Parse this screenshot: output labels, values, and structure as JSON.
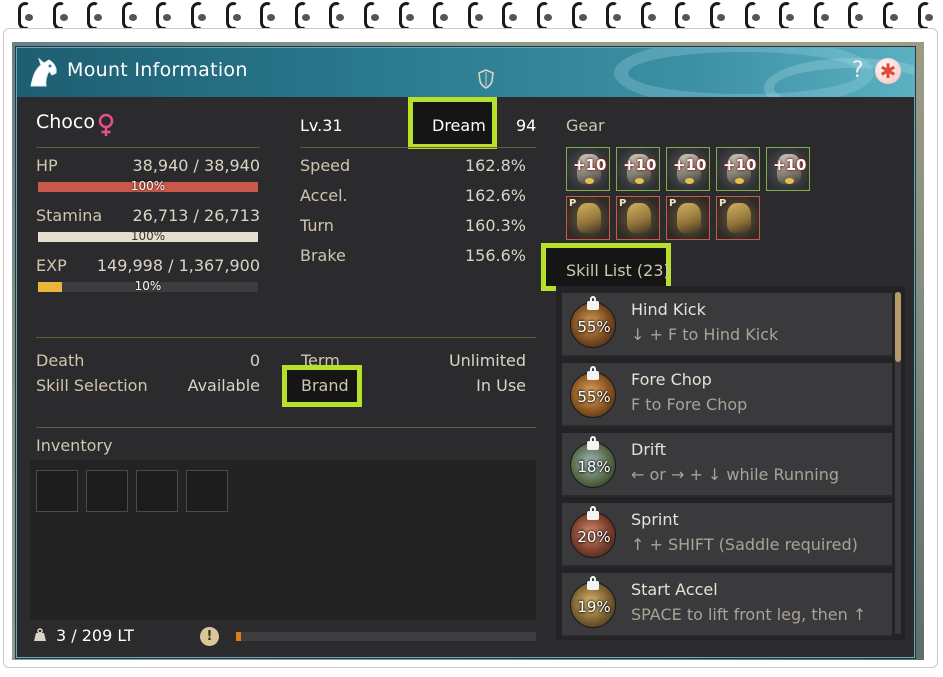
{
  "window": {
    "title": "Mount Information",
    "help_label": "?"
  },
  "mount": {
    "name": "Choco",
    "level": "Lv.31",
    "grade": "Dream",
    "defense_value": "94"
  },
  "stats_left": [
    {
      "label": "HP",
      "value": "38,940 / 38,940",
      "percent_label": "100%",
      "fraction": 1.0,
      "color": "#c8584a"
    },
    {
      "label": "Stamina",
      "value": "26,713 / 26,713",
      "percent_label": "100%",
      "fraction": 1.0,
      "color": "#e4dfcd"
    },
    {
      "label": "EXP",
      "value": "149,998 / 1,367,900",
      "percent_label": "10%",
      "fraction": 0.1097,
      "color": "#e9b53a"
    }
  ],
  "stats_right": [
    {
      "label": "Speed",
      "value": "162.8%"
    },
    {
      "label": "Accel.",
      "value": "162.6%"
    },
    {
      "label": "Turn",
      "value": "160.3%"
    },
    {
      "label": "Brake",
      "value": "156.6%"
    }
  ],
  "info": {
    "death_label": "Death",
    "death_value": "0",
    "skill_selection_label": "Skill Selection",
    "skill_selection_value": "Available",
    "term_label": "Term",
    "term_value": "Unlimited",
    "brand_label": "Brand",
    "brand_value": "In Use"
  },
  "inventory": {
    "label": "Inventory",
    "weight": "3 / 209 LT",
    "weight_fraction": 0.0144,
    "slots": 4
  },
  "gear": {
    "label": "Gear",
    "row1": [
      {
        "enhancement": "+10"
      },
      {
        "enhancement": "+10"
      },
      {
        "enhancement": "+10"
      },
      {
        "enhancement": "+10"
      },
      {
        "enhancement": "+10"
      }
    ],
    "row2": [
      {
        "marker": "P"
      },
      {
        "marker": "P"
      },
      {
        "marker": "P"
      },
      {
        "marker": "P"
      }
    ]
  },
  "skill_list": {
    "label": "Skill List (23)",
    "items": [
      {
        "name": "Hind Kick",
        "desc": "↓ + F to Hind Kick",
        "percent": "55%"
      },
      {
        "name": "Fore Chop",
        "desc": "F to Fore Chop",
        "percent": "55%"
      },
      {
        "name": "Drift",
        "desc": "← or → + ↓ while Running",
        "percent": "18%"
      },
      {
        "name": "Sprint",
        "desc": "↑ + SHIFT (Saddle required)",
        "percent": "20%"
      },
      {
        "name": "Start Accel",
        "desc": "SPACE to lift front leg, then ↑",
        "percent": "19%"
      }
    ]
  },
  "colors": {
    "highlight": "#b6e02a",
    "accent_title": "#2c7d92",
    "label": "#cfc6ad"
  }
}
